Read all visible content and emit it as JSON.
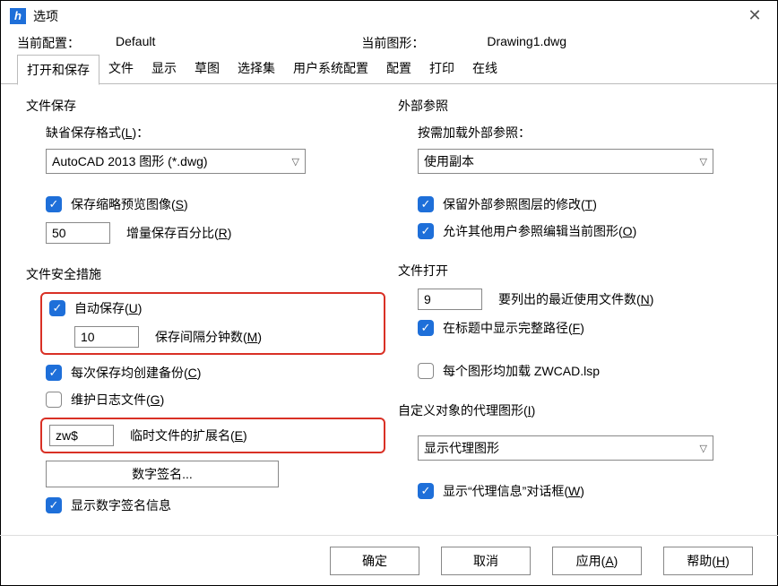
{
  "window": {
    "title": "选项"
  },
  "info": {
    "current_config_label": "当前配置：",
    "current_config_value": "Default",
    "current_drawing_label": "当前图形：",
    "current_drawing_value": "Drawing1.dwg"
  },
  "tabs": [
    "打开和保存",
    "文件",
    "显示",
    "草图",
    "选择集",
    "用户系统配置",
    "配置",
    "打印",
    "在线"
  ],
  "file_save": {
    "title": "文件保存",
    "format_label_pre": "缺省保存格式(",
    "format_key": "L",
    "format_label_post": ")：",
    "format_value": "AutoCAD 2013 图形 (*.dwg)",
    "thumb_pre": "保存缩略预览图像(",
    "thumb_key": "S",
    "thumb_post": ")",
    "incr_value": "50",
    "incr_label_pre": "增量保存百分比(",
    "incr_key": "R",
    "incr_label_post": ")"
  },
  "file_safety": {
    "title": "文件安全措施",
    "autosave_pre": "自动保存(",
    "autosave_key": "U",
    "autosave_post": ")",
    "interval_value": "10",
    "interval_label_pre": "保存间隔分钟数(",
    "interval_key": "M",
    "interval_label_post": ")",
    "backup_pre": "每次保存均创建备份(",
    "backup_key": "C",
    "backup_post": ")",
    "log_pre": "维护日志文件(",
    "log_key": "G",
    "log_post": ")",
    "temp_ext_value": "zw$",
    "temp_ext_label_pre": "临时文件的扩展名(",
    "temp_ext_key": "E",
    "temp_ext_label_post": ")",
    "sig_button": "数字签名...",
    "show_sig": "显示数字签名信息"
  },
  "xref": {
    "title": "外部参照",
    "load_label": "按需加载外部参照：",
    "load_value": "使用副本",
    "retain_pre": "保留外部参照图层的修改(",
    "retain_key": "T",
    "retain_post": ")",
    "allow_pre": "允许其他用户参照编辑当前图形(",
    "allow_key": "O",
    "allow_post": ")"
  },
  "file_open": {
    "title": "文件打开",
    "recent_value": "9",
    "recent_pre": "要列出的最近使用文件数(",
    "recent_key": "N",
    "recent_post": ")",
    "fullpath_pre": "在标题中显示完整路径(",
    "fullpath_key": "F",
    "fullpath_post": ")",
    "load_lsp": "每个图形均加载 ZWCAD.lsp"
  },
  "proxy": {
    "title_pre": "自定义对象的代理图形(",
    "title_key": "I",
    "title_post": ")",
    "value": "显示代理图形",
    "show_pre": "显示“代理信息”对话框(",
    "show_key": "W",
    "show_post": ")"
  },
  "footer": {
    "ok": "确定",
    "cancel": "取消",
    "apply_pre": "应用(",
    "apply_key": "A",
    "apply_post": ")",
    "help_pre": "帮助(",
    "help_key": "H",
    "help_post": ")"
  }
}
